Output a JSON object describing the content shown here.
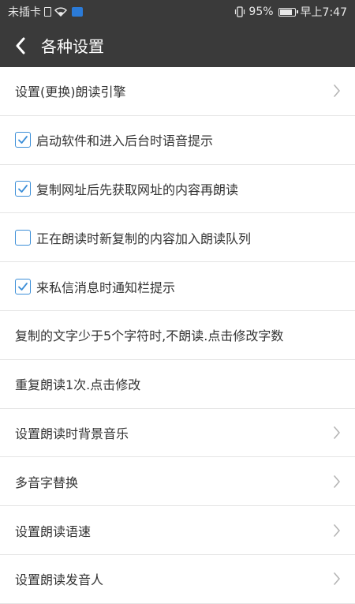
{
  "status_bar": {
    "carrier": "未插卡",
    "battery_pct": "95%",
    "time": "早上7:47"
  },
  "header": {
    "title": "各种设置"
  },
  "settings": [
    {
      "label": "设置(更换)朗读引擎",
      "kind": "nav"
    },
    {
      "label": "启动软件和进入后台时语音提示",
      "kind": "checkbox",
      "checked": true
    },
    {
      "label": "复制网址后先获取网址的内容再朗读",
      "kind": "checkbox",
      "checked": true
    },
    {
      "label": "正在朗读时新复制的内容加入朗读队列",
      "kind": "checkbox",
      "checked": false
    },
    {
      "label": "来私信消息时通知栏提示",
      "kind": "checkbox",
      "checked": true
    },
    {
      "label": "复制的文字少于5个字符时,不朗读.点击修改字数",
      "kind": "text"
    },
    {
      "label": "重复朗读1次.点击修改",
      "kind": "text"
    },
    {
      "label": "设置朗读时背景音乐",
      "kind": "nav"
    },
    {
      "label": "多音字替换",
      "kind": "nav"
    },
    {
      "label": "设置朗读语速",
      "kind": "nav"
    },
    {
      "label": "设置朗读发音人",
      "kind": "nav"
    }
  ],
  "colors": {
    "header_bg": "#3a3a3a",
    "checkbox_accent": "#3d8fd8",
    "chevron": "#b5b5b5"
  }
}
